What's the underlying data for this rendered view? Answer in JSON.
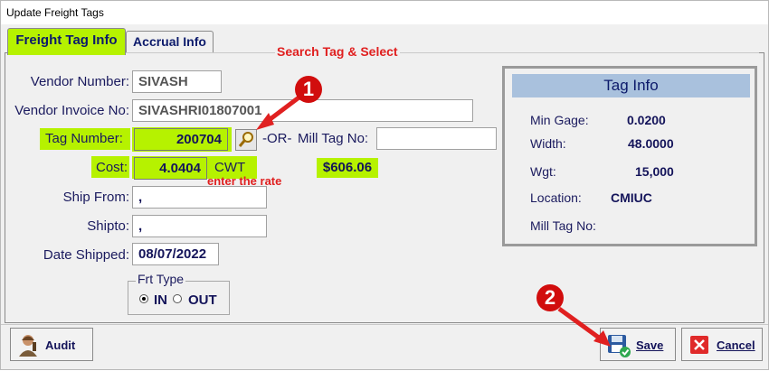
{
  "window": {
    "title": "Update Freight Tags"
  },
  "tabs": [
    {
      "label": "Freight Tag Info",
      "active": true
    },
    {
      "label": "Accrual Info",
      "active": false
    }
  ],
  "annotations": {
    "search": "Search Tag & Select",
    "rate": "enter the rate",
    "step1": "1",
    "step2": "2"
  },
  "form": {
    "vendor_number": {
      "label": "Vendor Number:",
      "value": "SIVASH"
    },
    "vendor_invoice": {
      "label": "Vendor Invoice No:",
      "value": "SIVASHRI01807001"
    },
    "tag_number": {
      "label": "Tag Number:",
      "value": "200704"
    },
    "or_text": "-OR-",
    "mill_tag": {
      "label": "Mill Tag No:",
      "value": ""
    },
    "cost": {
      "label": "Cost:",
      "value": "4.0404",
      "unit": "CWT",
      "total": "$606.06"
    },
    "ship_from": {
      "label": "Ship From:",
      "value": ","
    },
    "ship_to": {
      "label": "Shipto:",
      "value": ","
    },
    "date_shipped": {
      "label": "Date Shipped:",
      "value": "08/07/2022"
    },
    "frt_type": {
      "label": "Frt Type",
      "options": [
        "IN",
        "OUT"
      ],
      "selected": "IN"
    }
  },
  "tag_info": {
    "title": "Tag Info",
    "rows": [
      {
        "label": "Min Gage:",
        "value": "0.0200"
      },
      {
        "label": "Width:",
        "value": "48.0000"
      },
      {
        "label": "Wgt:",
        "value": "15,000"
      },
      {
        "label": "Location:",
        "value": "CMIUC"
      },
      {
        "label": "Mill Tag No:",
        "value": ""
      }
    ]
  },
  "buttons": {
    "audit": "Audit",
    "save": "Save",
    "cancel": "Cancel"
  },
  "colors": {
    "highlight": "#b6f200",
    "annotation": "#e02020",
    "badge": "#d10d0d",
    "taginfo_header": "#a9c1dd"
  }
}
